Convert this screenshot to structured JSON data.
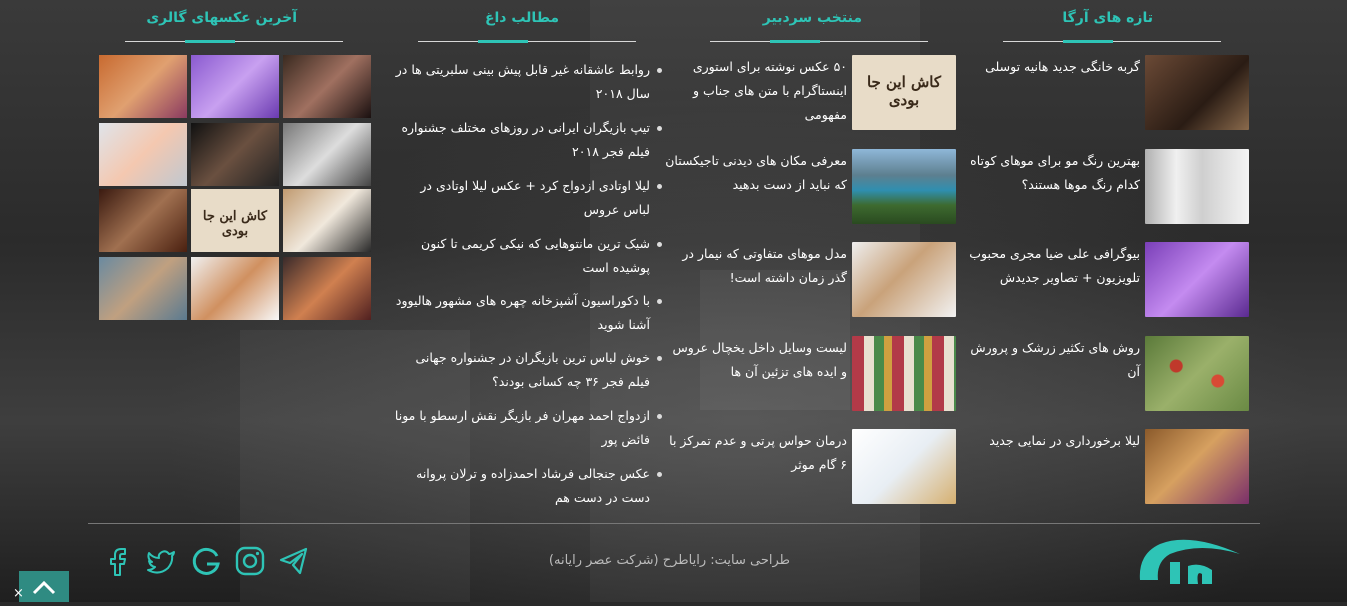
{
  "columns": {
    "latest": {
      "title": "تازه های آرگا",
      "items": [
        {
          "title": "گربه خانگی جدید هانیه توسلی"
        },
        {
          "title": "بهترین رنگ مو برای موهای کوتاه کدام رنگ موها هستند؟"
        },
        {
          "title": "بیوگرافی علی ضیا مجری محبوب تلویزیون + تصاویر جدیدش"
        },
        {
          "title": "روش های تکثیر زرشک و پرورش آن"
        },
        {
          "title": "لیلا برخورداری در نمایی جدید"
        }
      ]
    },
    "editors": {
      "title": "منتخب سردبیر",
      "items": [
        {
          "title": "۵۰ عکس نوشته برای استوری اینستاگرام با متن های جناب و مفهومی",
          "thumb_text": "کاش این جا بودی"
        },
        {
          "title": "معرفی مکان های دیدنی تاجیکستان که نباید از دست بدهید"
        },
        {
          "title": "مدل موهای متفاوتی که نیمار در گذر زمان داشته است!"
        },
        {
          "title": "لیست وسایل داخل یخچال عروس و ایده های تزئین آن ها"
        },
        {
          "title": "درمان حواس پرتی و عدم تمرکز با ۶ گام موثر"
        }
      ]
    },
    "hot": {
      "title": "مطالب داغ",
      "items": [
        "روابط عاشقانه غیر قابل پیش بینی سلبریتی ها در سال ۲۰۱۸",
        "تیپ بازیگران ایرانی در روزهای مختلف جشنواره فیلم فجر ۲۰۱۸",
        "لیلا اوتادی ازدواج کرد + عکس لیلا اوتادی در لباس عروس",
        "شیک ترین مانتوهایی که نیکی کریمی تا کنون پوشیده است",
        "با دکوراسیون آشپزخانه چهره های مشهور هالیوود آشنا شوید",
        "خوش لباس ترین بازیگران در جشنواره جهانی فیلم فجر ۳۶ چه کسانی بودند؟",
        "ازدواج احمد مهران فر بازیگر نقش ارسطو با مونا فائض پور",
        "عکس جنجالی فرشاد احمدزاده و ترلان پروانه دست در دست هم"
      ]
    },
    "gallery": {
      "title": "آخرین عکسهای گالری",
      "thumb_text": "کاش این جا بودی"
    }
  },
  "footer": {
    "credit": "طراحی سایت: رایاطرح (شرکت عصر رایانه)",
    "close_label": "×"
  },
  "colors": {
    "accent": "#2ec4b6"
  },
  "icons": [
    "facebook-icon",
    "twitter-icon",
    "google-icon",
    "instagram-icon",
    "telegram-icon"
  ]
}
